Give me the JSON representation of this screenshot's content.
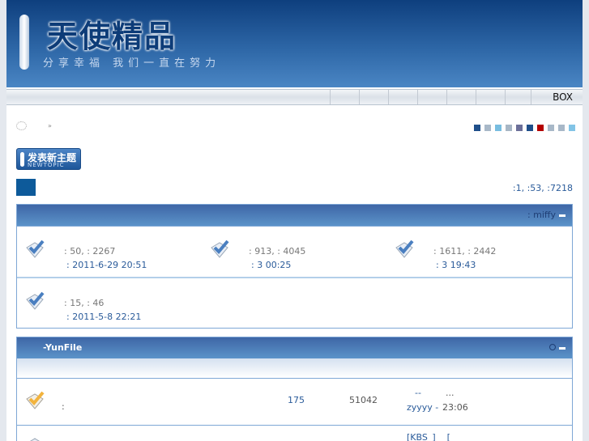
{
  "header": {
    "logo": "天使精品",
    "tagline": "分享幸福 我们一直在努力"
  },
  "nav": {
    "box_label": "BOX"
  },
  "breadcrumb": {
    "sep": "»"
  },
  "theme_colors": [
    "#1f4f8a",
    "#a8b8c8",
    "#78bde0",
    "#a7b6c5",
    "#6c6f99",
    "#1f4f8a",
    "#b40000",
    "#a8b8c8",
    "#a8b8c8",
    "#82c4e6"
  ],
  "new_topic": {
    "label": "发表新主题",
    "sub": "NEWTOPIC"
  },
  "stats": ":1, :53, :7218",
  "cat1": {
    "moderator": ": miffy",
    "forums": [
      {
        "counts": ": 50, : 2267",
        "last": ": 2011-6-29 20:51"
      },
      {
        "counts": ": 913, : 4045",
        "last": ": 3    00:25"
      },
      {
        "counts": ": 1611, : 2442",
        "last": ": 3    19:43"
      },
      {
        "counts": ": 15, : 46",
        "last": ": 2011-5-8 22:21"
      }
    ]
  },
  "cat2": {
    "title": "-YunFile",
    "forum": {
      "desc": ":",
      "topics": "175",
      "posts": "51042",
      "last_title": "--",
      "last_more": "...",
      "last_user": "zyyyy -",
      "last_time": "23:06"
    },
    "next_last": "[KBS_]    ["
  }
}
